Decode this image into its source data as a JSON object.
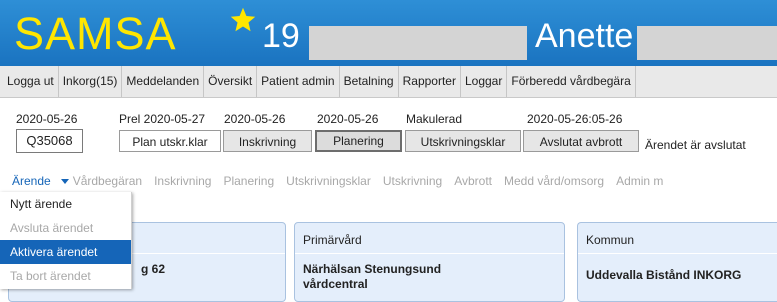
{
  "header": {
    "logo": "SAMSA",
    "number": "19",
    "name": "Anette",
    "colors": {
      "background": "#1a73c0",
      "logo": "#ffe600",
      "star": "#ffe600"
    }
  },
  "main_menu": [
    "Logga ut",
    "Inkorg(15)",
    "Meddelanden",
    "Översikt",
    "Patient admin",
    "Betalning",
    "Rapporter",
    "Loggar",
    "Förberedd vårdbegära"
  ],
  "status": {
    "case_date": "2020-05-26",
    "case_number": "Q35068",
    "prel_date": "Prel 2020-05-27",
    "step_dates": [
      "2020-05-26",
      "2020-05-26",
      "Makulerad",
      "2020-05-26:05-26"
    ],
    "steps": [
      "Plan utskr.klar",
      "Inskrivning",
      "Planering",
      "Utskrivningsklar",
      "Avslutat avbrott"
    ],
    "closed_text": "Ärendet är avslutat"
  },
  "subnav": {
    "active": "Ärende",
    "items": [
      "Vårdbegäran",
      "Inskrivning",
      "Planering",
      "Utskrivningsklar",
      "Utskrivning",
      "Avbrott",
      "Medd vård/omsorg",
      "Admin m"
    ]
  },
  "dropdown": {
    "items": [
      {
        "label": "Nytt ärende",
        "state": "enabled"
      },
      {
        "label": "Avsluta ärendet",
        "state": "disabled"
      },
      {
        "label": "Aktivera ärendet",
        "state": "selected"
      },
      {
        "label": "Ta bort ärendet",
        "state": "disabled"
      }
    ]
  },
  "panels": {
    "first": {
      "value": "g 62"
    },
    "primarvard": {
      "title": "Primärvård",
      "value": "Närhälsan Stenungsund vårdcentral"
    },
    "kommun": {
      "title": "Kommun",
      "value": "Uddevalla Bistånd INKORG"
    }
  }
}
